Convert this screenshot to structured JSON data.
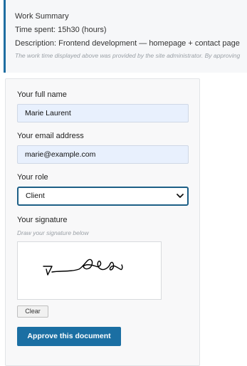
{
  "summary": {
    "title": "Work Summary",
    "time_spent": "Time spent: 15h30 (hours)",
    "description": "Description: Frontend development — homepage + contact page",
    "note": "The work time displayed above was provided by the site administrator. By approving"
  },
  "form": {
    "name_label": "Your full name",
    "name_value": "Marie Laurent",
    "email_label": "Your email address",
    "email_value": "marie@example.com",
    "role_label": "Your role",
    "role_value": "Client",
    "signature_label": "Your signature",
    "signature_hint": "Draw your signature below",
    "clear_label": "Clear",
    "approve_label": "Approve this document"
  },
  "colors": {
    "accent": "#1b6fa3",
    "input_bg": "#e8f0fd",
    "summary_bg": "#f6f7f9"
  }
}
